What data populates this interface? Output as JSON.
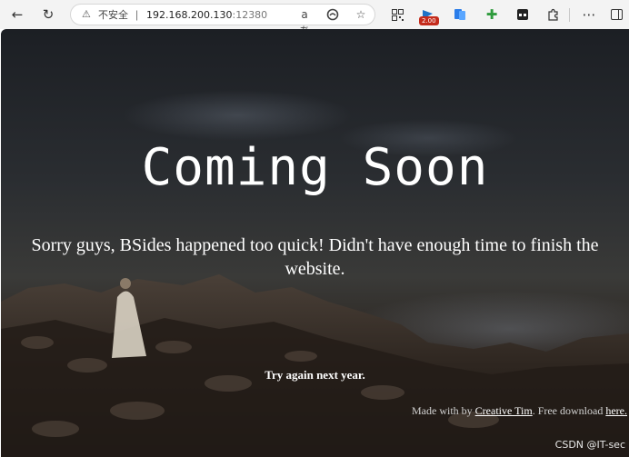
{
  "browser": {
    "insecure_label": "不安全",
    "separator": "|",
    "url_host": "192.168.200.130",
    "url_port": ":12380",
    "read_aloud_label": "aあ",
    "extension_badge": "2.00",
    "icons": {
      "back": "back-arrow-icon",
      "refresh": "refresh-icon",
      "warning": "warning-icon",
      "read_aloud": "read-aloud-icon",
      "edge_refresh": "edge-icon",
      "favorite": "star-icon",
      "qr": "qr-code-icon",
      "extension_badge": "flag-extension-icon",
      "translate": "translate-extension-icon",
      "plus_extension": "plus-extension-icon",
      "collections": "collections-icon",
      "extensions": "puzzle-icon",
      "menu": "more-icon",
      "sidebar": "sidebar-icon"
    }
  },
  "page": {
    "headline": "Coming Soon",
    "message": "Sorry guys, BSides happened too quick! Didn't have enough time to finish the website.",
    "subtext": "Try again next year.",
    "footer": {
      "prefix": "Made with by ",
      "author_link": "Creative Tim",
      "middle": ". Free download ",
      "download_link": "here."
    }
  },
  "watermark": "CSDN @IT-sec"
}
